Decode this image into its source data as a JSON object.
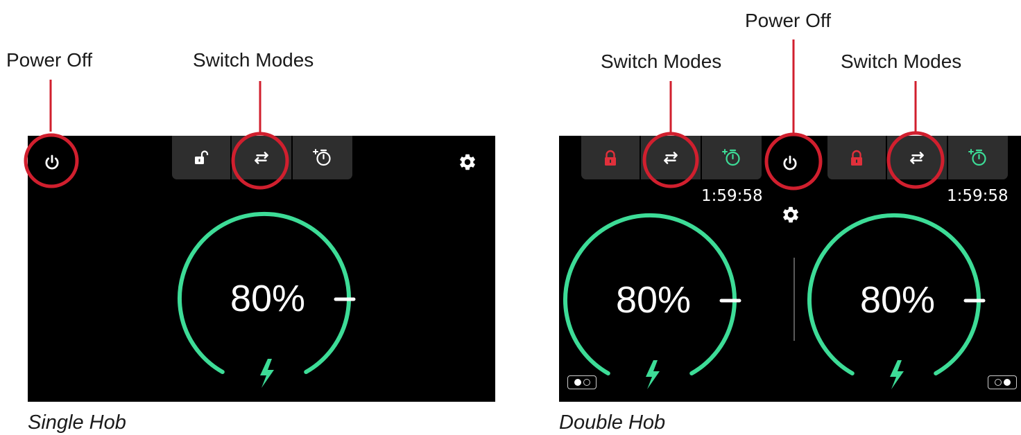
{
  "callouts": {
    "single_power_off": "Power Off",
    "single_switch_modes": "Switch Modes",
    "double_power_off": "Power Off",
    "double_switch_modes_left": "Switch Modes",
    "double_switch_modes_right": "Switch Modes"
  },
  "captions": {
    "single": "Single Hob",
    "double": "Double Hob"
  },
  "single_hob": {
    "power_percent": "80%",
    "level_fraction": 0.8,
    "lock_state": "unlocked",
    "icons": [
      "power-icon",
      "unlock-icon",
      "switch-modes-icon",
      "add-timer-icon",
      "gear-icon",
      "bolt-icon"
    ]
  },
  "double_hob": {
    "left": {
      "power_percent": "80%",
      "timer": "1:59:58",
      "lock_state": "locked",
      "zone": "left"
    },
    "right": {
      "power_percent": "80%",
      "timer": "1:59:58",
      "lock_state": "locked",
      "zone": "right"
    },
    "icons": [
      "lock-icon",
      "switch-modes-icon",
      "add-timer-icon",
      "power-icon",
      "gear-icon",
      "bolt-icon"
    ]
  },
  "colors": {
    "accent_green": "#3ddc97",
    "lock_red": "#e0303b",
    "callout_red": "#d11f2e",
    "screen_bg": "#000000",
    "button_bg": "#2e2e2e"
  }
}
